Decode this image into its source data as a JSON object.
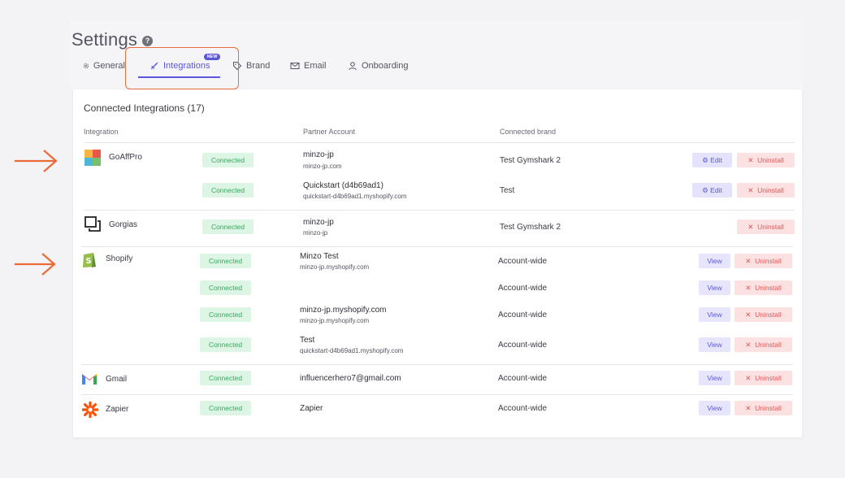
{
  "page": {
    "title": "Settings"
  },
  "tabs": [
    {
      "label": "General",
      "icon": "gear-icon"
    },
    {
      "label": "Integrations",
      "icon": "rocket-icon",
      "badge": "NEW",
      "active": true
    },
    {
      "label": "Brand",
      "icon": "tag-icon"
    },
    {
      "label": "Email",
      "icon": "envelope-icon"
    },
    {
      "label": "Onboarding",
      "icon": "user-icon"
    }
  ],
  "card": {
    "title": "Connected Integrations (17)",
    "columns": {
      "integration": "Integration",
      "partner": "Partner Account",
      "brand": "Connected brand"
    }
  },
  "integrations": {
    "goaffpro": {
      "name": "GoAffPro",
      "rows": [
        {
          "status": "Connected",
          "account": "minzo-jp",
          "account_sub": "minzo-jp.com",
          "brand": "Test Gymshark 2",
          "action": "Edit",
          "uninstall": "Uninstall"
        },
        {
          "status": "Connected",
          "account": "Quickstart (d4b69ad1)",
          "account_sub": "quickstart-d4b69ad1.myshopify.com",
          "brand": "Test",
          "action": "Edit",
          "uninstall": "Uninstall"
        }
      ]
    },
    "gorgias": {
      "name": "Gorgias",
      "rows": [
        {
          "status": "Connected",
          "account": "minzo-jp",
          "account_sub": "minzo-jp",
          "brand": "Test Gymshark 2",
          "uninstall": "Uninstall"
        }
      ]
    },
    "shopify": {
      "name": "Shopify",
      "rows": [
        {
          "status": "Connected",
          "account": "Minzo Test",
          "account_sub": "minzo-jp.myshopify.com",
          "brand": "Account-wide",
          "action": "View",
          "uninstall": "Uninstall"
        },
        {
          "status": "Connected",
          "account": "",
          "account_sub": "",
          "brand": "Account-wide",
          "action": "View",
          "uninstall": "Uninstall"
        },
        {
          "status": "Connected",
          "account": "minzo-jp.myshopify.com",
          "account_sub": "minzo-jp.myshopify.com",
          "brand": "Account-wide",
          "action": "View",
          "uninstall": "Uninstall"
        },
        {
          "status": "Connected",
          "account": "Test",
          "account_sub": "quickstart-d4b69ad1.myshopify.com",
          "brand": "Account-wide",
          "action": "View",
          "uninstall": "Uninstall"
        }
      ]
    },
    "gmail": {
      "name": "Gmail",
      "rows": [
        {
          "status": "Connected",
          "account": "influencerhero7@gmail.com",
          "brand": "Account-wide",
          "action": "View",
          "uninstall": "Uninstall"
        }
      ]
    },
    "zapier": {
      "name": "Zapier",
      "rows": [
        {
          "status": "Connected",
          "account": "Zapier",
          "brand": "Account-wide",
          "action": "View",
          "uninstall": "Uninstall"
        }
      ]
    }
  },
  "colors": {
    "accent": "#5b57d6",
    "annotation": "#ec6a3a",
    "connected_bg": "#dcf5e4",
    "connected_text": "#3aa85f",
    "danger_bg": "#fbe1e1",
    "danger_text": "#e05656"
  }
}
